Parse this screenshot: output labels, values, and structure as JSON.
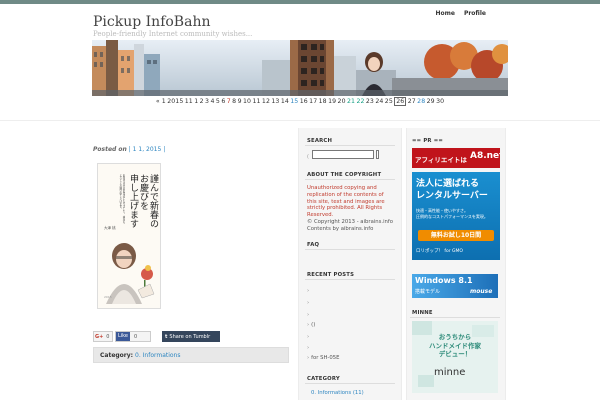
{
  "site": {
    "title": "Pickup InfoBahn",
    "tagline": "People-friendly Internet community wishes..."
  },
  "nav": [
    "Home",
    "Profile"
  ],
  "date_strip": {
    "prefix": "« 1",
    "year": "2015",
    "days": [
      "11",
      "1",
      "2",
      "3",
      "4",
      "5",
      "6",
      "7",
      "8",
      "9",
      "10",
      "11",
      "12",
      "13",
      "14",
      "15",
      "16",
      "17",
      "18",
      "19",
      "20",
      "21",
      "22",
      "23",
      "24",
      "25",
      "26",
      "27",
      "28",
      "29",
      "30"
    ],
    "selected_index": 26,
    "colors": {
      "red": [
        "7"
      ],
      "blue": [
        "15",
        "28"
      ],
      "green": [
        "21",
        "22"
      ]
    }
  },
  "post": {
    "meta_label": "Posted on",
    "meta_value": "| 1 1, 2015 |",
    "card_heading": "謹んで新春の\nお慶びを\n申し上げます",
    "card_side_text": "旧年中は大変お世話になりました。本年もよろしくお願い申し上げます。",
    "card_signature": "大津 桃",
    "card_year": "2015",
    "share": {
      "gplus": "G+",
      "gplus_count": "0",
      "facebook_like": "Like",
      "facebook_count": "0",
      "tumblr": "Share on Tumblr"
    },
    "category_label": "Category:",
    "category_value": "0. Informations"
  },
  "sidebar1": {
    "search_heading": "SEARCH",
    "search_prefix": "(",
    "about_heading": "ABOUT THE COPYRIGHT",
    "about_text": "Unauthorized copying and replication of the contents of this site, text and images are strictly prohibited. All Rights Reserved.",
    "about_copyright": "© Copyright 2013 - aibrains.info",
    "about_contents": "Contents by aibrains.info",
    "faq_heading": "FAQ",
    "recent_heading": "RECENT POSTS",
    "recent_items": [
      "",
      "",
      "",
      "()",
      "",
      "",
      "for  SH-05E"
    ],
    "category_heading": "CATEGORY",
    "category_item": "0. Informations (11)"
  },
  "sidebar2": {
    "pr_heading": "== PR ==",
    "ad1_text": "アフィリエイトは",
    "ad1_brand": "A8.net",
    "ad2_headline": "法人に選ばれる\nレンタルサーバー",
    "ad2_sub": "快適・高性能・使いやすさ。\n圧倒的なコストパフォーマンスを実現。",
    "ad2_cta": "無料お試し10日間",
    "ad2_brand": "ロリポップ！ for GMO",
    "ad3_text": "Windows 8.1",
    "ad3_sub": "搭載モデル",
    "ad3_brand": "mouse",
    "minne_heading": "MINNE",
    "ad4_text": "おうちから\nハンドメイド作家\nデビュー！",
    "ad4_brand": "minne"
  },
  "colors": {
    "accent_red": "#c0392b",
    "link_blue": "#2e86c1",
    "topline": "#6f8a86"
  }
}
